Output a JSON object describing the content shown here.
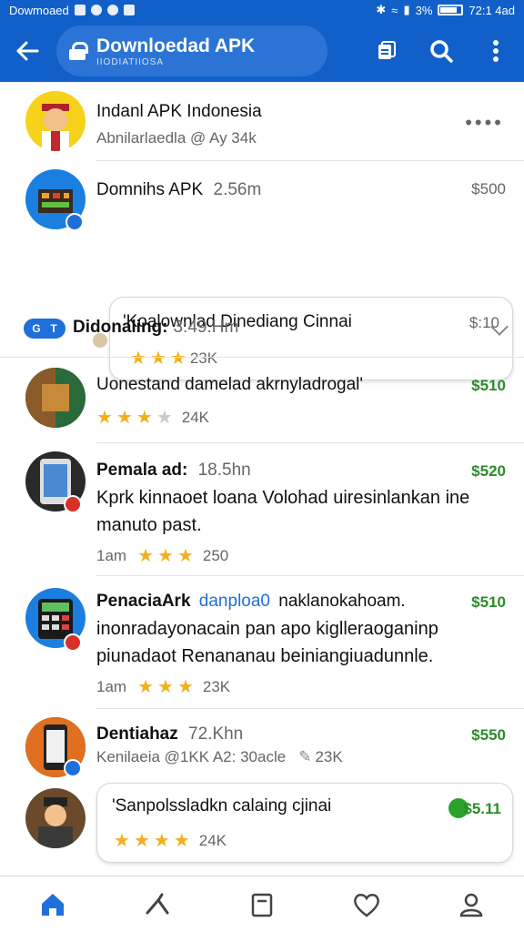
{
  "status_bar": {
    "carrier": "Dowmoaed",
    "battery": "3%",
    "time": "72:1 4ad"
  },
  "appbar": {
    "title": "Downloedad APK",
    "subtitle": "IIODIATIIOSA"
  },
  "items": [
    {
      "title": "Indanl APK Indonesia",
      "sub": "Abnilarlaedla @ Ay 34k"
    },
    {
      "title": "Domnihs APK",
      "meta": "2.56m",
      "price": "$500",
      "card_text": "'Koalownlad Dinediang Cinnai",
      "card_price": "$:10",
      "card_rating": "23K"
    },
    {
      "title": "Uonestand damelad akrnyladrogal'",
      "price": "$510",
      "rating_count": "24K"
    },
    {
      "title": "Pemala ad:",
      "meta": "18.5hn",
      "price": "$520",
      "desc": "Kprk kinnaoet loana Volohad uiresinlankan ine manuto past.",
      "time": "1am",
      "rating_count": "250"
    },
    {
      "title": "PenaciaArk",
      "title_link": "danploa0",
      "title_rest": "naklanokahoam.",
      "price": "$510",
      "desc": "inonradayonacain pan apo kiglleraoganinp piunadaot Renananau beiniangiuadunnle.",
      "time": "1am",
      "rating_count": "23K"
    },
    {
      "title": "Dentiahaz",
      "meta": "72.Khn",
      "price": "$550",
      "sub": "Kenilaeia @1KK A2: 30acle",
      "sub_rating": "23K",
      "card_text": "'Sanpolssladkn calaing cjinai",
      "card_price": "$5.11",
      "card_rating": "24K"
    }
  ],
  "section": {
    "pill_left": "G",
    "pill_right": "T",
    "title": "Didonaling:",
    "meta": "3:49.Hm"
  },
  "colors": {
    "primary": "#1160c9",
    "price_green": "#2a8c2a",
    "star": "#f2b01e"
  }
}
